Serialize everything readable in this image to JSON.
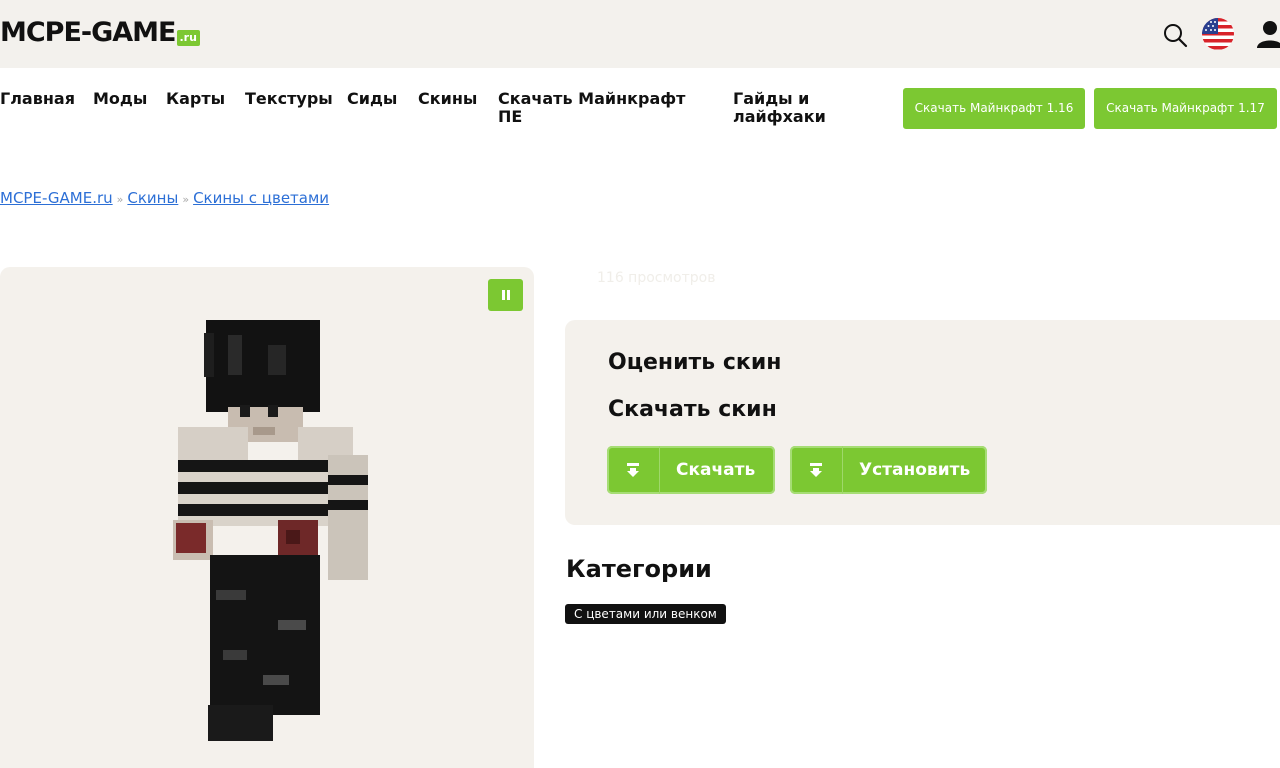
{
  "header": {
    "logo_text": "MCPE-GAME",
    "logo_suffix": ".ru",
    "accent_color": "#7cc832",
    "icons": [
      "search-icon",
      "us-flag-icon",
      "user-icon"
    ]
  },
  "nav": {
    "items": [
      "Главная",
      "Моды",
      "Карты",
      "Текстуры",
      "Сиды",
      "Скины",
      "Скачать Майнкрафт ПЕ",
      "Гайды и лайфхаки"
    ],
    "buttons": [
      "Скачать Майнкрафт 1.16",
      "Скачать Майнкрафт 1.17"
    ]
  },
  "breadcrumb": {
    "items": [
      "MCPE-GAME.ru",
      "Скины",
      "Скины с цветами"
    ],
    "separator": "»"
  },
  "preview": {
    "pause_icon": "pause-icon"
  },
  "skin": {
    "views": "116 просмотров",
    "rate_title": "Оценить скин",
    "download_title": "Скачать скин",
    "download_label": "Скачать",
    "install_label": "Установить"
  },
  "categories": {
    "title": "Категории",
    "tags": [
      "С цветами или венком"
    ]
  }
}
